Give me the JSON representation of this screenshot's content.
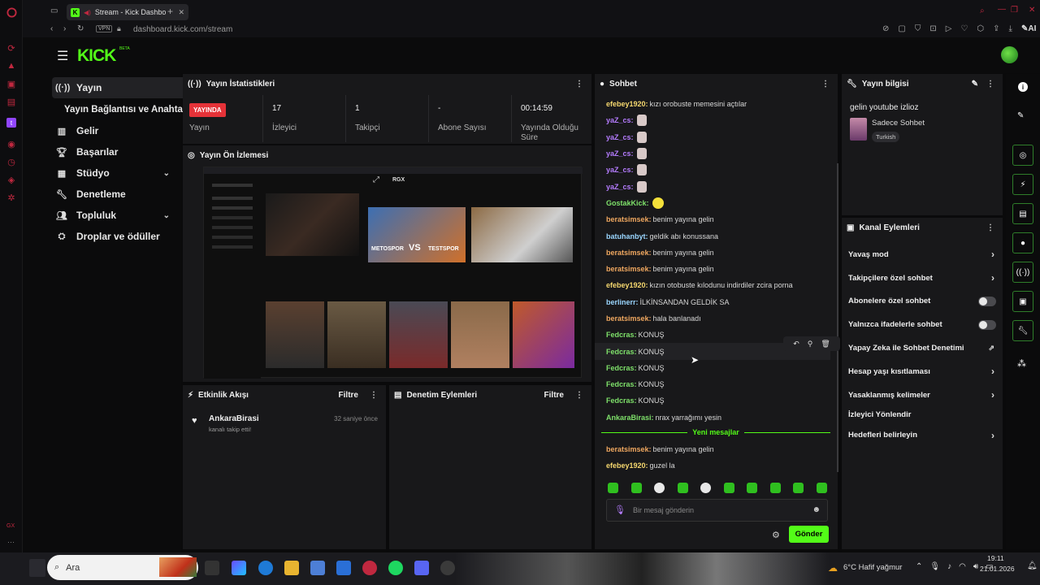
{
  "browser": {
    "tab_title": "Stream - Kick Dashbo",
    "url": "dashboard.kick.com/stream",
    "vpn": "VPN",
    "ai_label": "AI",
    "gx_label": "GX"
  },
  "app": {
    "logo": "KICK",
    "logo_beta": "BETA"
  },
  "nav": {
    "items": [
      {
        "label": "Yayın",
        "icon": "broadcast-icon"
      },
      {
        "label": "Yayın Bağlantısı ve Anahtarı",
        "icon": ""
      },
      {
        "label": "Gelir",
        "icon": "chart-icon"
      },
      {
        "label": "Başarılar",
        "icon": "trophy-icon"
      },
      {
        "label": "Stüdyo",
        "icon": "grid-icon"
      },
      {
        "label": "Denetleme",
        "icon": "wrench-icon"
      },
      {
        "label": "Topluluk",
        "icon": "people-icon"
      },
      {
        "label": "Droplar ve ödüller",
        "icon": "gift-icon"
      }
    ]
  },
  "stats": {
    "title": "Yayın İstatistikleri",
    "live_badge": "YAYINDA",
    "items": [
      {
        "value": "",
        "label": "Yayın"
      },
      {
        "value": "17",
        "label": "İzleyici"
      },
      {
        "value": "1",
        "label": "Takipçi"
      },
      {
        "value": "-",
        "label": "Abone Sayısı"
      },
      {
        "value": "00:14:59",
        "label": "Yayında Olduğu Süre"
      }
    ]
  },
  "preview": {
    "title": "Yayın Ön İzlemesi",
    "thumb_tag": "RGX",
    "thumb_text_1": "METOSPOR",
    "thumb_text_2": "VS",
    "thumb_text_3": "TESTSPOR"
  },
  "activity": {
    "title": "Etkinlik Akışı",
    "filter": "Filtre",
    "event_user": "AnkaraBirasi",
    "event_text": "kanalı takip etti!",
    "event_time": "32 saniye önce"
  },
  "moderation": {
    "title": "Denetim Eylemleri",
    "filter": "Filtre"
  },
  "chat": {
    "title": "Sohbet",
    "messages": [
      {
        "user": "efebey1920:",
        "text": "kızı orobuste memesini açtılar",
        "color": "#f5d76e",
        "emote": false
      },
      {
        "user": "yaZ_cs:",
        "text": "",
        "color": "#b57cff",
        "emote": true
      },
      {
        "user": "yaZ_cs:",
        "text": "",
        "color": "#b57cff",
        "emote": true
      },
      {
        "user": "yaZ_cs:",
        "text": "",
        "color": "#b57cff",
        "emote": true
      },
      {
        "user": "yaZ_cs:",
        "text": "",
        "color": "#b57cff",
        "emote": true
      },
      {
        "user": "yaZ_cs:",
        "text": "",
        "color": "#b57cff",
        "emote": true
      },
      {
        "user": "GostakKick:",
        "text": "",
        "color": "#7ee06a",
        "emote": true
      },
      {
        "user": "beratsimsek:",
        "text": "benim yayına gelin",
        "color": "#f0a860",
        "emote": false
      },
      {
        "user": "batuhanbyt:",
        "text": "geldik abı konussana",
        "color": "#9ad6ff",
        "emote": false
      },
      {
        "user": "beratsimsek:",
        "text": "benim yayına gelin",
        "color": "#f0a860",
        "emote": false
      },
      {
        "user": "beratsimsek:",
        "text": "benim yayına gelin",
        "color": "#f0a860",
        "emote": false
      },
      {
        "user": "efebey1920:",
        "text": "kızın otobuste kılodunu indirdiler zcira porna",
        "color": "#f5d76e",
        "emote": false
      },
      {
        "user": "berlinerr:",
        "text": "İLKİNSANDAN GELDİK SA",
        "color": "#9ad6ff",
        "emote": false
      },
      {
        "user": "beratsimsek:",
        "text": "hala banlanadı",
        "color": "#f0a860",
        "emote": false
      },
      {
        "user": "Fedcras:",
        "text": "KONUŞ",
        "color": "#7ee06a",
        "emote": false
      },
      {
        "user": "Fedcras:",
        "text": "KONUŞ",
        "color": "#7ee06a",
        "emote": false
      },
      {
        "user": "Fedcras:",
        "text": "KONUŞ",
        "color": "#7ee06a",
        "emote": false
      },
      {
        "user": "Fedcras:",
        "text": "KONUŞ",
        "color": "#7ee06a",
        "emote": false
      },
      {
        "user": "Fedcras:",
        "text": "KONUŞ",
        "color": "#7ee06a",
        "emote": false
      },
      {
        "user": "AnkaraBirasi:",
        "text": "nrax yarrağımı yesin",
        "color": "#7ee06a",
        "emote": false
      }
    ],
    "new_messages": "Yeni mesajlar",
    "after_messages": [
      {
        "user": "beratsimsek:",
        "text": "benim yayına gelin",
        "color": "#f0a860"
      },
      {
        "user": "efebey1920:",
        "text": "guzel la",
        "color": "#f5d76e"
      }
    ],
    "input_placeholder": "Bir mesaj gönderin",
    "send": "Gönder"
  },
  "stream_info": {
    "title": "Yayın bilgisi",
    "stream_title": "gelin youtube izlioz",
    "category": "Sadece Sohbet",
    "language": "Turkish"
  },
  "channel_actions": {
    "title": "Kanal Eylemleri",
    "items": [
      {
        "label": "Yavaş mod",
        "control": "chevron"
      },
      {
        "label": "Takipçilere özel sohbet",
        "control": "chevron"
      },
      {
        "label": "Abonelere özel sohbet",
        "control": "toggle"
      },
      {
        "label": "Yalnızca ifadelerle sohbet",
        "control": "toggle"
      },
      {
        "label": "Yapay Zeka ile Sohbet Denetimi",
        "control": "external"
      },
      {
        "label": "Hesap yaşı kısıtlaması",
        "control": "chevron"
      },
      {
        "label": "Yasaklanmış kelimeler",
        "control": "chevron"
      },
      {
        "label": "İzleyici Yönlendir",
        "control": "none"
      },
      {
        "label": "Hedefleri belirleyin",
        "control": "chevron"
      }
    ]
  },
  "taskbar": {
    "search": "Ara",
    "weather": "6°C  Hafif yağmur",
    "time": "19:11",
    "date": "21.01.2026"
  },
  "colors": {
    "accent": "#53fc18",
    "live": "#e53238",
    "panel": "#18181a"
  }
}
